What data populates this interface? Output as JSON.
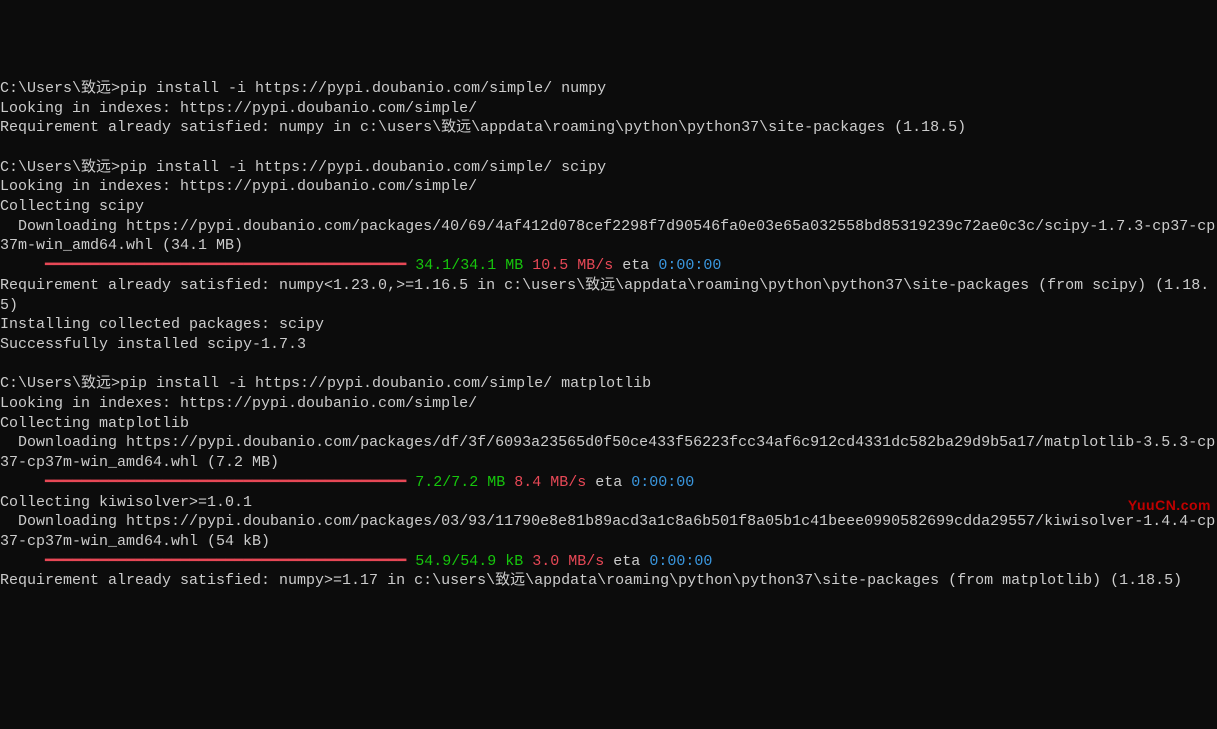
{
  "terminal": {
    "lines": [
      {
        "type": "plain",
        "text": "C:\\Users\\致远>pip install -i https://pypi.doubanio.com/simple/ numpy"
      },
      {
        "type": "plain",
        "text": "Looking in indexes: https://pypi.doubanio.com/simple/"
      },
      {
        "type": "plain",
        "text": "Requirement already satisfied: numpy in c:\\users\\致远\\appdata\\roaming\\python\\python37\\site-packages (1.18.5)"
      },
      {
        "type": "blank"
      },
      {
        "type": "plain",
        "text": "C:\\Users\\致远>pip install -i https://pypi.doubanio.com/simple/ scipy"
      },
      {
        "type": "plain",
        "text": "Looking in indexes: https://pypi.doubanio.com/simple/"
      },
      {
        "type": "plain",
        "text": "Collecting scipy"
      },
      {
        "type": "plain",
        "text": "  Downloading https://pypi.doubanio.com/packages/40/69/4af412d078cef2298f7d90546fa0e03e65a032558bd85319239c72ae0c3c/scipy-1.7.3-cp37-cp37m-win_amd64.whl (34.1 MB)"
      },
      {
        "type": "progress",
        "bar": "     ━━━━━━━━━━━━━━━━━━━━━━━━━━━━━━━━━━━━━━━━ ",
        "size": "34.1/34.1 MB",
        "speed": " 10.5 MB/s",
        "eta_label": " eta ",
        "eta_value": "0:00:00"
      },
      {
        "type": "plain",
        "text": "Requirement already satisfied: numpy<1.23.0,>=1.16.5 in c:\\users\\致远\\appdata\\roaming\\python\\python37\\site-packages (from scipy) (1.18.5)"
      },
      {
        "type": "plain",
        "text": "Installing collected packages: scipy"
      },
      {
        "type": "plain",
        "text": "Successfully installed scipy-1.7.3"
      },
      {
        "type": "blank"
      },
      {
        "type": "plain",
        "text": "C:\\Users\\致远>pip install -i https://pypi.doubanio.com/simple/ matplotlib"
      },
      {
        "type": "plain",
        "text": "Looking in indexes: https://pypi.doubanio.com/simple/"
      },
      {
        "type": "plain",
        "text": "Collecting matplotlib"
      },
      {
        "type": "plain",
        "text": "  Downloading https://pypi.doubanio.com/packages/df/3f/6093a23565d0f50ce433f56223fcc34af6c912cd4331dc582ba29d9b5a17/matplotlib-3.5.3-cp37-cp37m-win_amd64.whl (7.2 MB)"
      },
      {
        "type": "progress",
        "bar": "     ━━━━━━━━━━━━━━━━━━━━━━━━━━━━━━━━━━━━━━━━ ",
        "size": "7.2/7.2 MB",
        "speed": " 8.4 MB/s",
        "eta_label": " eta ",
        "eta_value": "0:00:00"
      },
      {
        "type": "plain",
        "text": "Collecting kiwisolver>=1.0.1"
      },
      {
        "type": "plain",
        "text": "  Downloading https://pypi.doubanio.com/packages/03/93/11790e8e81b89acd3a1c8a6b501f8a05b1c41beee0990582699cdda29557/kiwisolver-1.4.4-cp37-cp37m-win_amd64.whl (54 kB)"
      },
      {
        "type": "progress",
        "bar": "     ━━━━━━━━━━━━━━━━━━━━━━━━━━━━━━━━━━━━━━━━ ",
        "size": "54.9/54.9 kB",
        "speed": " 3.0 MB/s",
        "eta_label": " eta ",
        "eta_value": "0:00:00"
      },
      {
        "type": "plain",
        "text": "Requirement already satisfied: numpy>=1.17 in c:\\users\\致远\\appdata\\roaming\\python\\python37\\site-packages (from matplotlib) (1.18.5)"
      }
    ]
  },
  "watermark": "YuuCN.com"
}
